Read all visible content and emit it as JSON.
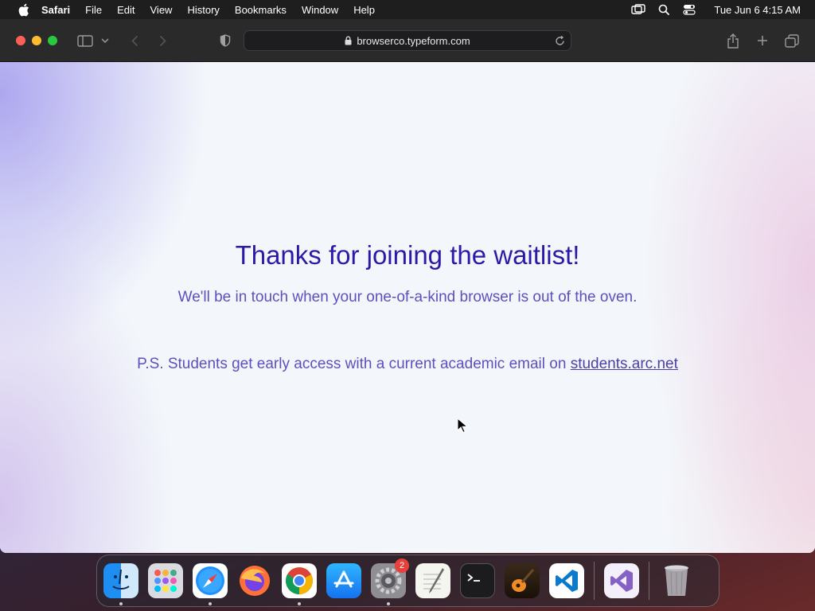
{
  "menubar": {
    "app_name": "Safari",
    "items": [
      "File",
      "Edit",
      "View",
      "History",
      "Bookmarks",
      "Window",
      "Help"
    ],
    "clock": "Tue Jun 6  4:15 AM"
  },
  "browser": {
    "url": "browserco.typeform.com"
  },
  "page": {
    "headline": "Thanks for joining the waitlist!",
    "subline": "We'll be in touch when your one-of-a-kind browser is out of the oven.",
    "ps_text": "P.S. Students get early access with a current academic email on ",
    "ps_link": "students.arc.net",
    "headline_color": "#2b1aa8",
    "text_color": "#5d4fc0"
  },
  "dock": {
    "badge_count": "2",
    "apps": [
      "Finder",
      "Launchpad",
      "Safari",
      "Firefox",
      "Chrome",
      "App Store",
      "System Preferences",
      "TextEdit",
      "Terminal",
      "GarageBand",
      "VS Code",
      "Visual Studio",
      "Trash"
    ]
  }
}
